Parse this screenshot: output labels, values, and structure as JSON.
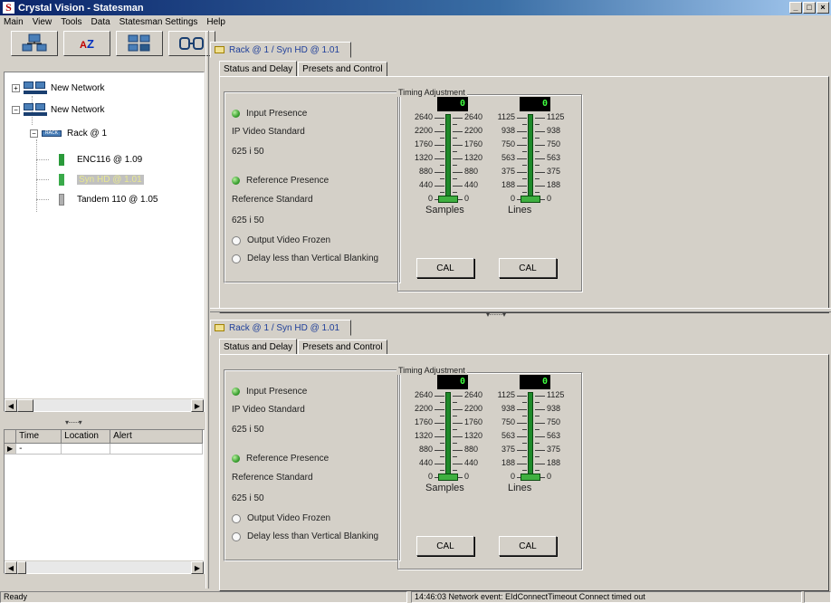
{
  "window": {
    "app_icon_letter": "S",
    "title": "Crystal Vision - Statesman",
    "controls": {
      "minimize": "_",
      "maximize": "□",
      "close": "×"
    }
  },
  "menu": [
    "Main",
    "View",
    "Tools",
    "Data",
    "Statesman Settings",
    "Help"
  ],
  "toolbar": {
    "buttons": [
      {
        "icon": "network-view-icon"
      },
      {
        "icon": "sort-az-icon",
        "a": "A",
        "z": "Z"
      },
      {
        "icon": "device-grid-icon"
      },
      {
        "icon": "connect-icon"
      }
    ]
  },
  "tree": {
    "nodes": [
      {
        "label": "New Network",
        "expander": "+"
      },
      {
        "label": "New Network",
        "expander": "−"
      },
      {
        "label": "Rack @ 1",
        "expander": "−",
        "badge": "RACK"
      },
      {
        "label": "ENC116 @ 1.09"
      },
      {
        "label": "Syn HD @ 1.01",
        "selected": true
      },
      {
        "label": "Tandem 110 @ 1.05"
      }
    ]
  },
  "alerts": {
    "columns": [
      "Time",
      "Location",
      "Alert"
    ],
    "rows": [
      [
        "-",
        "",
        ""
      ]
    ]
  },
  "panes": [
    {
      "title": "Rack @ 1 / Syn HD @ 1.01",
      "tabs": [
        "Status and Delay",
        "Presets and Control"
      ],
      "status": {
        "input_presence": "Input Presence",
        "ip_video_standard_label": "IP Video Standard",
        "ip_video_standard_value": "625 i 50",
        "reference_presence": "Reference Presence",
        "reference_standard_label": "Reference Standard",
        "reference_standard_value": "625 i 50",
        "output_video_frozen": "Output Video Frozen",
        "delay_less": "Delay less than Vertical Blanking"
      },
      "timing": {
        "legend": "Timing Adjustment",
        "samples": {
          "readout": "0",
          "caption": "Samples",
          "ticks": [
            "2640",
            "2200",
            "1760",
            "1320",
            "880",
            "440",
            "0"
          ],
          "value_fraction": 0.0
        },
        "lines": {
          "readout": "0",
          "caption": "Lines",
          "ticks": [
            "1125",
            "938",
            "750",
            "563",
            "375",
            "188",
            "0"
          ],
          "value_fraction": 0.0
        },
        "cal_label": "CAL"
      }
    },
    {
      "title": "Rack @ 1 / Syn HD @ 1.01",
      "tabs": [
        "Status and Delay",
        "Presets and Control"
      ],
      "status": {
        "input_presence": "Input Presence",
        "ip_video_standard_label": "IP Video Standard",
        "ip_video_standard_value": "625 i 50",
        "reference_presence": "Reference Presence",
        "reference_standard_label": "Reference Standard",
        "reference_standard_value": "625 i 50",
        "output_video_frozen": "Output Video Frozen",
        "delay_less": "Delay less than Vertical Blanking"
      },
      "timing": {
        "legend": "Timing Adjustment",
        "samples": {
          "readout": "0",
          "caption": "Samples",
          "ticks": [
            "2640",
            "2200",
            "1760",
            "1320",
            "880",
            "440",
            "0"
          ],
          "value_fraction": 0.0
        },
        "lines": {
          "readout": "0",
          "caption": "Lines",
          "ticks": [
            "1125",
            "938",
            "750",
            "563",
            "375",
            "188",
            "0"
          ],
          "value_fraction": 0.0
        },
        "cal_label": "CAL"
      }
    }
  ],
  "statusbar": {
    "left": "Ready",
    "message": "14:46:03 Network event: EIdConnectTimeout Connect timed out"
  },
  "colors": {
    "led_green": "#3aa030",
    "slider_green": "#1f8a2a",
    "readout_fg": "#40ff40",
    "link_blue": "#1f3f9a"
  }
}
